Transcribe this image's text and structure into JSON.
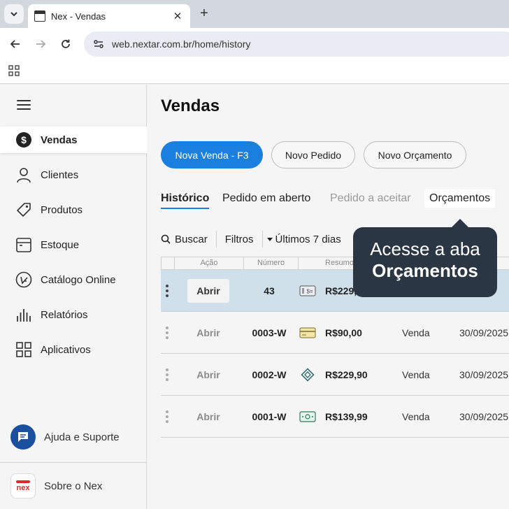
{
  "browser": {
    "tab_title": "Nex - Vendas",
    "url": "web.nextar.com.br/home/history"
  },
  "sidebar": {
    "items": [
      {
        "label": "Vendas",
        "icon": "dollar-circle-icon",
        "active": true
      },
      {
        "label": "Clientes",
        "icon": "user-icon"
      },
      {
        "label": "Produtos",
        "icon": "tag-icon"
      },
      {
        "label": "Estoque",
        "icon": "box-icon"
      },
      {
        "label": "Catálogo Online",
        "icon": "catalog-icon"
      },
      {
        "label": "Relatórios",
        "icon": "bar-chart-icon"
      },
      {
        "label": "Aplicativos",
        "icon": "apps-grid-icon"
      }
    ],
    "help_label": "Ajuda e Suporte",
    "about_label": "Sobre o Nex",
    "logo_text": "nex"
  },
  "main": {
    "title": "Vendas",
    "buttons": {
      "new_sale": "Nova Venda - F3",
      "new_order": "Novo Pedido",
      "new_quote": "Novo Orçamento"
    },
    "tabs": [
      {
        "label": "Histórico",
        "state": "active"
      },
      {
        "label": "Pedido em aberto",
        "state": "normal"
      },
      {
        "label": "Pedido a aceitar",
        "state": "disabled"
      },
      {
        "label": "Orçamentos",
        "state": "highlight"
      }
    ],
    "filters": {
      "search": "Buscar",
      "filters": "Filtros",
      "period": "Últimos 7 dias"
    },
    "table": {
      "headers": [
        "Ação",
        "Número",
        "Resumo"
      ],
      "open_label": "Abrir",
      "rows": [
        {
          "number": "43",
          "pay_icon": "pix-terminal-icon",
          "amount": "R$229,",
          "type": "",
          "date": "",
          "date_tail": "25",
          "selected": true
        },
        {
          "number": "0003-W",
          "pay_icon": "card-icon",
          "amount": "R$90,00",
          "type": "Venda",
          "date": "30/09/2025"
        },
        {
          "number": "0002-W",
          "pay_icon": "pix-icon",
          "amount": "R$229,90",
          "type": "Venda",
          "date": "30/09/2025"
        },
        {
          "number": "0001-W",
          "pay_icon": "cash-icon",
          "amount": "R$139,99",
          "type": "Venda",
          "date": "30/09/2025"
        }
      ]
    }
  },
  "callout": {
    "line1": "Acesse a aba",
    "line2": "Orçamentos"
  },
  "colors": {
    "primary": "#1a7fde",
    "callout_bg": "#2b3645",
    "selected_row": "#cfe0ea",
    "help_icon_bg": "#1a4fa0",
    "brand_red": "#d92d2d"
  }
}
